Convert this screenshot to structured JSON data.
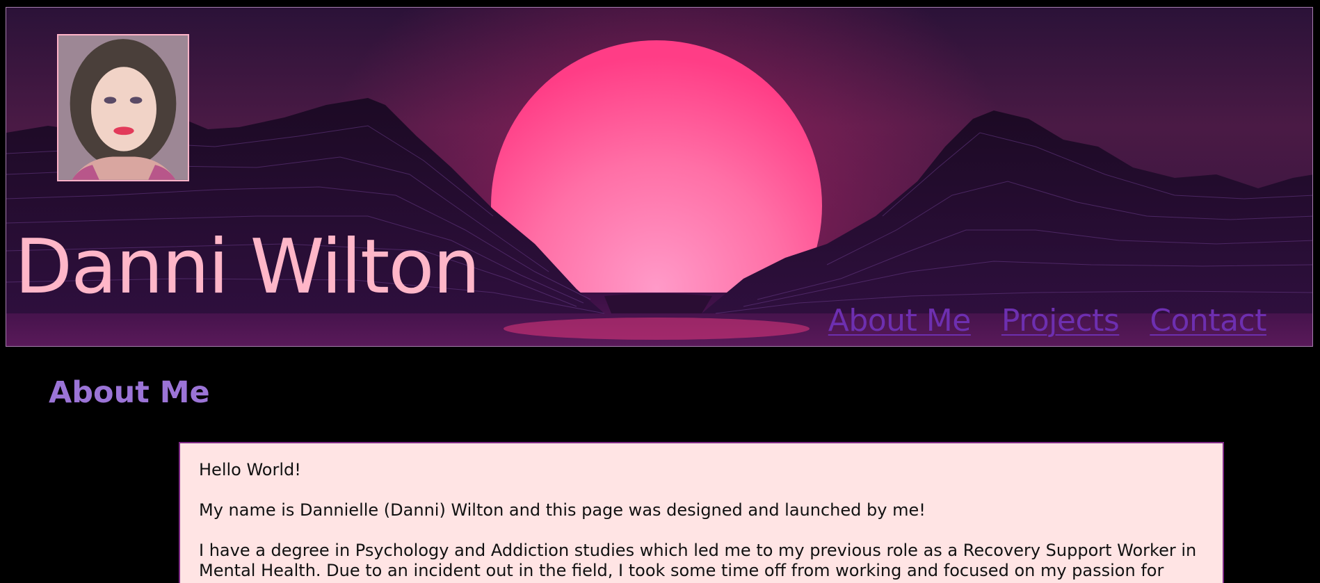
{
  "header": {
    "site_title": "Danni Wilton",
    "nav": [
      {
        "label": "About Me"
      },
      {
        "label": "Projects"
      },
      {
        "label": "Contact"
      }
    ]
  },
  "main": {
    "heading": "About Me",
    "paragraphs": [
      "Hello World!",
      "My name is Dannielle (Danni) Wilton and this page was designed and launched by me!",
      "I have a degree in Psychology and Addiction studies which led me to my previous role as a Recovery Support Worker in Mental Health. Due to an incident out in the field, I took some time off from working and focused on my passion for"
    ]
  },
  "colors": {
    "background": "#000000",
    "title": "#ffb6c8",
    "nav_link": "#6d2fb0",
    "heading": "#9b74d6",
    "content_bg": "#ffe4e4",
    "content_border": "#7e2a86"
  }
}
